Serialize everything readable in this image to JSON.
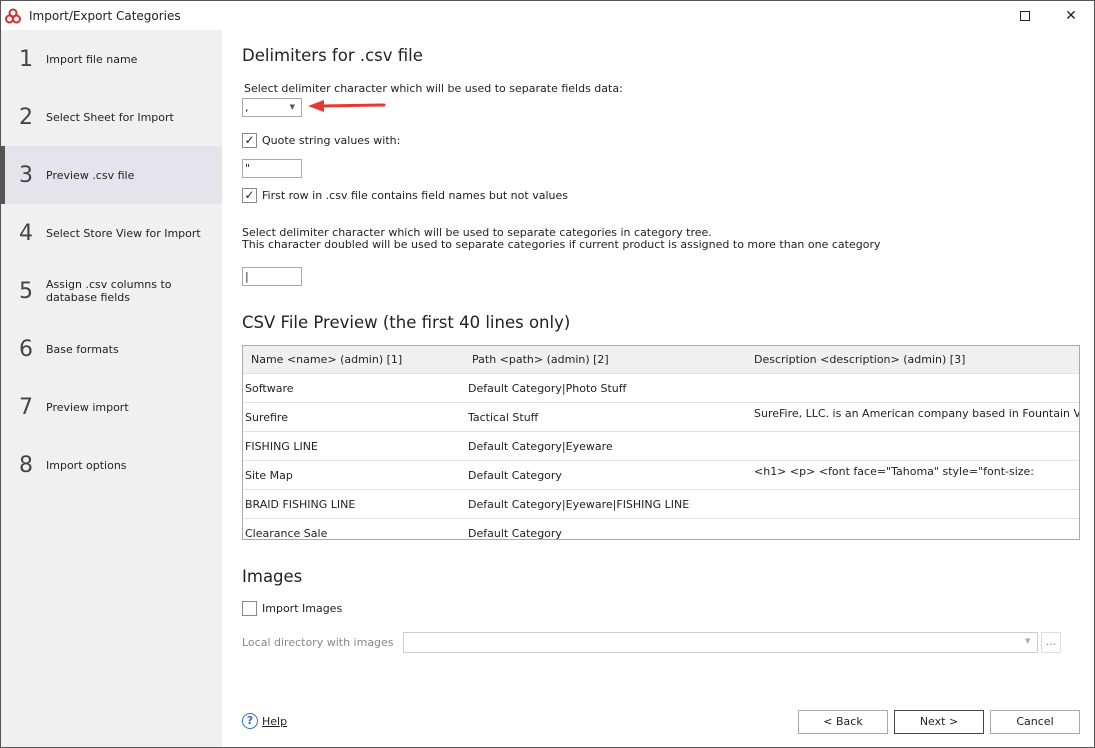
{
  "window": {
    "title": "Import/Export Categories",
    "brand_color": "#d32f2f"
  },
  "sidebar": {
    "steps": [
      {
        "num": "1",
        "label": "Import file name"
      },
      {
        "num": "2",
        "label": "Select Sheet for Import"
      },
      {
        "num": "3",
        "label": "Preview .csv file",
        "active": true
      },
      {
        "num": "4",
        "label": "Select Store View for Import"
      },
      {
        "num": "5",
        "label": "Assign .csv columns to database fields"
      },
      {
        "num": "6",
        "label": "Base formats"
      },
      {
        "num": "7",
        "label": "Preview import"
      },
      {
        "num": "8",
        "label": "Import options"
      }
    ]
  },
  "delimiters": {
    "heading": "Delimiters for .csv file",
    "field_label": "Select delimiter character which will be used to separate fields data:",
    "field_value": ",",
    "quote_label": "Quote string values with:",
    "quote_checked": true,
    "quote_value": "\"",
    "first_row_label": "First row in .csv file contains field names but not values",
    "first_row_checked": true,
    "category_label_1": "Select delimiter character which will be used to separate categories in category tree.",
    "category_label_2": "This character doubled will be used to separate categories if current product is assigned to more than one category",
    "category_value": "|",
    "arrow_color": "#e53935"
  },
  "preview": {
    "heading": "CSV File Preview (the first 40 lines only)",
    "columns": [
      "Name <name> (admin) [1]",
      "Path <path> (admin) [2]",
      "Description <description> (admin) [3]"
    ],
    "rows": [
      [
        "Software",
        "Default Category|Photo Stuff",
        ""
      ],
      [
        "Surefire",
        "Tactical Stuff",
        "SureFire, LLC. is an American company based in Fountain Valley"
      ],
      [
        "FISHING LINE",
        "Default Category|Eyeware",
        ""
      ],
      [
        "Site Map",
        "Default Category",
        "<h1> <p> <font face=\"Tahoma\" style=\"font-size:"
      ],
      [
        "BRAID FISHING LINE",
        "Default Category|Eyeware|FISHING LINE",
        ""
      ],
      [
        "Clearance Sale",
        "Default Category",
        ""
      ]
    ]
  },
  "images": {
    "heading": "Images",
    "import_label": "Import Images",
    "import_checked": false,
    "dir_label": "Local directory with images",
    "dir_value": "",
    "browse": "..."
  },
  "footer": {
    "help": "Help",
    "back": "< Back",
    "next": "Next >",
    "cancel": "Cancel"
  }
}
